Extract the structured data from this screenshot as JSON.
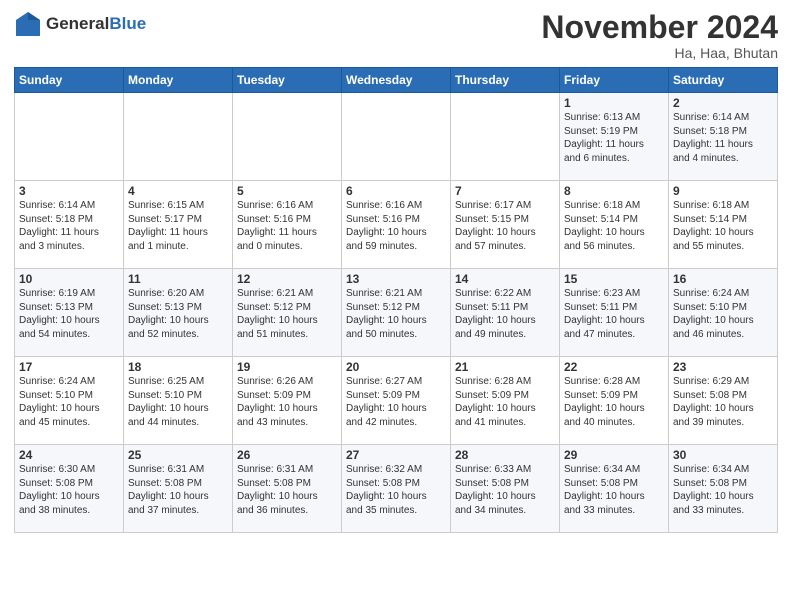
{
  "header": {
    "logo_line1": "General",
    "logo_line2": "Blue",
    "month": "November 2024",
    "location": "Ha, Haa, Bhutan"
  },
  "weekdays": [
    "Sunday",
    "Monday",
    "Tuesday",
    "Wednesday",
    "Thursday",
    "Friday",
    "Saturday"
  ],
  "weeks": [
    [
      {
        "day": "",
        "info": ""
      },
      {
        "day": "",
        "info": ""
      },
      {
        "day": "",
        "info": ""
      },
      {
        "day": "",
        "info": ""
      },
      {
        "day": "",
        "info": ""
      },
      {
        "day": "1",
        "info": "Sunrise: 6:13 AM\nSunset: 5:19 PM\nDaylight: 11 hours\nand 6 minutes."
      },
      {
        "day": "2",
        "info": "Sunrise: 6:14 AM\nSunset: 5:18 PM\nDaylight: 11 hours\nand 4 minutes."
      }
    ],
    [
      {
        "day": "3",
        "info": "Sunrise: 6:14 AM\nSunset: 5:18 PM\nDaylight: 11 hours\nand 3 minutes."
      },
      {
        "day": "4",
        "info": "Sunrise: 6:15 AM\nSunset: 5:17 PM\nDaylight: 11 hours\nand 1 minute."
      },
      {
        "day": "5",
        "info": "Sunrise: 6:16 AM\nSunset: 5:16 PM\nDaylight: 11 hours\nand 0 minutes."
      },
      {
        "day": "6",
        "info": "Sunrise: 6:16 AM\nSunset: 5:16 PM\nDaylight: 10 hours\nand 59 minutes."
      },
      {
        "day": "7",
        "info": "Sunrise: 6:17 AM\nSunset: 5:15 PM\nDaylight: 10 hours\nand 57 minutes."
      },
      {
        "day": "8",
        "info": "Sunrise: 6:18 AM\nSunset: 5:14 PM\nDaylight: 10 hours\nand 56 minutes."
      },
      {
        "day": "9",
        "info": "Sunrise: 6:18 AM\nSunset: 5:14 PM\nDaylight: 10 hours\nand 55 minutes."
      }
    ],
    [
      {
        "day": "10",
        "info": "Sunrise: 6:19 AM\nSunset: 5:13 PM\nDaylight: 10 hours\nand 54 minutes."
      },
      {
        "day": "11",
        "info": "Sunrise: 6:20 AM\nSunset: 5:13 PM\nDaylight: 10 hours\nand 52 minutes."
      },
      {
        "day": "12",
        "info": "Sunrise: 6:21 AM\nSunset: 5:12 PM\nDaylight: 10 hours\nand 51 minutes."
      },
      {
        "day": "13",
        "info": "Sunrise: 6:21 AM\nSunset: 5:12 PM\nDaylight: 10 hours\nand 50 minutes."
      },
      {
        "day": "14",
        "info": "Sunrise: 6:22 AM\nSunset: 5:11 PM\nDaylight: 10 hours\nand 49 minutes."
      },
      {
        "day": "15",
        "info": "Sunrise: 6:23 AM\nSunset: 5:11 PM\nDaylight: 10 hours\nand 47 minutes."
      },
      {
        "day": "16",
        "info": "Sunrise: 6:24 AM\nSunset: 5:10 PM\nDaylight: 10 hours\nand 46 minutes."
      }
    ],
    [
      {
        "day": "17",
        "info": "Sunrise: 6:24 AM\nSunset: 5:10 PM\nDaylight: 10 hours\nand 45 minutes."
      },
      {
        "day": "18",
        "info": "Sunrise: 6:25 AM\nSunset: 5:10 PM\nDaylight: 10 hours\nand 44 minutes."
      },
      {
        "day": "19",
        "info": "Sunrise: 6:26 AM\nSunset: 5:09 PM\nDaylight: 10 hours\nand 43 minutes."
      },
      {
        "day": "20",
        "info": "Sunrise: 6:27 AM\nSunset: 5:09 PM\nDaylight: 10 hours\nand 42 minutes."
      },
      {
        "day": "21",
        "info": "Sunrise: 6:28 AM\nSunset: 5:09 PM\nDaylight: 10 hours\nand 41 minutes."
      },
      {
        "day": "22",
        "info": "Sunrise: 6:28 AM\nSunset: 5:09 PM\nDaylight: 10 hours\nand 40 minutes."
      },
      {
        "day": "23",
        "info": "Sunrise: 6:29 AM\nSunset: 5:08 PM\nDaylight: 10 hours\nand 39 minutes."
      }
    ],
    [
      {
        "day": "24",
        "info": "Sunrise: 6:30 AM\nSunset: 5:08 PM\nDaylight: 10 hours\nand 38 minutes."
      },
      {
        "day": "25",
        "info": "Sunrise: 6:31 AM\nSunset: 5:08 PM\nDaylight: 10 hours\nand 37 minutes."
      },
      {
        "day": "26",
        "info": "Sunrise: 6:31 AM\nSunset: 5:08 PM\nDaylight: 10 hours\nand 36 minutes."
      },
      {
        "day": "27",
        "info": "Sunrise: 6:32 AM\nSunset: 5:08 PM\nDaylight: 10 hours\nand 35 minutes."
      },
      {
        "day": "28",
        "info": "Sunrise: 6:33 AM\nSunset: 5:08 PM\nDaylight: 10 hours\nand 34 minutes."
      },
      {
        "day": "29",
        "info": "Sunrise: 6:34 AM\nSunset: 5:08 PM\nDaylight: 10 hours\nand 33 minutes."
      },
      {
        "day": "30",
        "info": "Sunrise: 6:34 AM\nSunset: 5:08 PM\nDaylight: 10 hours\nand 33 minutes."
      }
    ]
  ]
}
